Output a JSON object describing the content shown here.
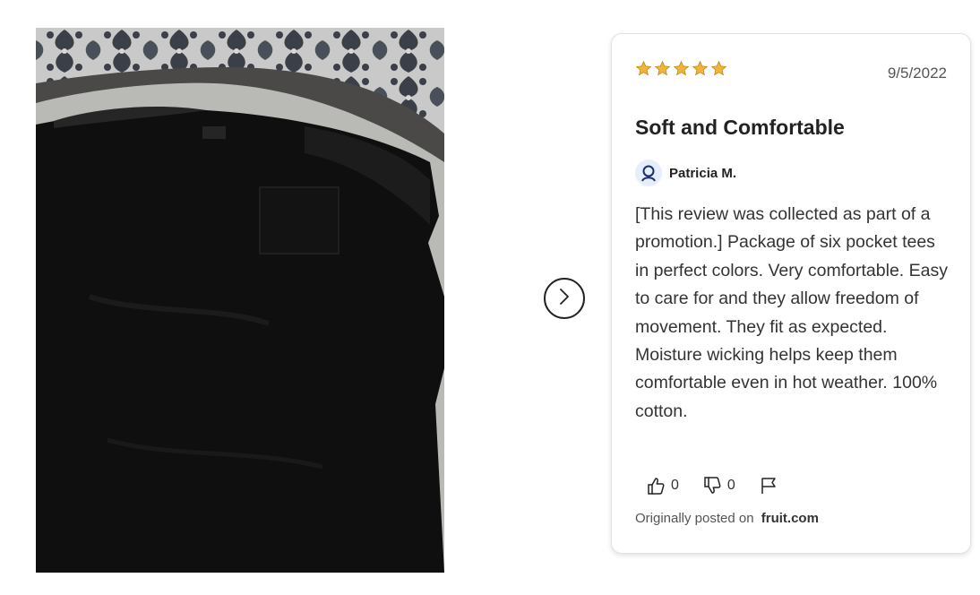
{
  "review": {
    "rating": 5,
    "star_color": "#f1b43a",
    "date": "9/5/2022",
    "title": "Soft and Comfortable",
    "author": "Patricia M.",
    "body": "[This review was collected as part of a promotion.] Package of six pocket tees in perfect colors. Very comfortable. Easy to care for and they allow freedom of movement. They fit as expected. Moisture wicking helps keep them comfortable even in hot weather. 100% cotton.",
    "helpful_count": "0",
    "not_helpful_count": "0",
    "origin_label": "Originally posted on",
    "origin_site": "fruit.com"
  },
  "icons": {
    "next": "chevron-right-icon",
    "avatar": "user-icon",
    "helpful": "thumbs-up-icon",
    "not_helpful": "thumbs-down-icon",
    "report": "flag-icon"
  }
}
